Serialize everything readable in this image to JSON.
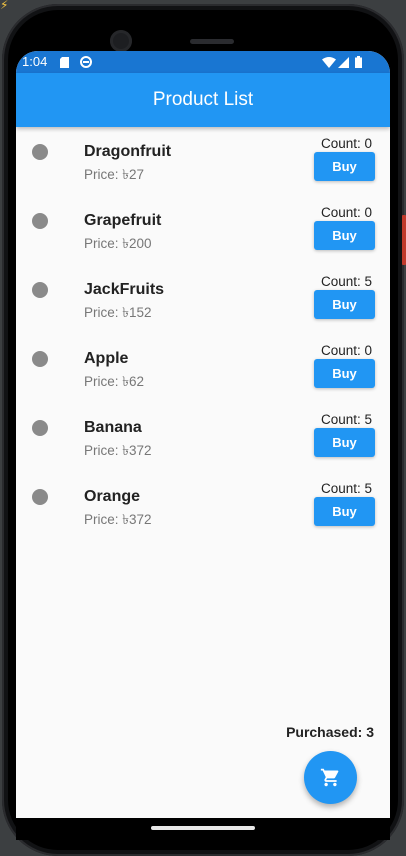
{
  "status_bar": {
    "time": "1:04"
  },
  "app_bar": {
    "title": "Product List"
  },
  "products": [
    {
      "name": "Dragonfruit",
      "price": "Price: ৳27",
      "count": "Count: 0",
      "buy_label": "Buy"
    },
    {
      "name": "Grapefruit",
      "price": "Price: ৳200",
      "count": "Count: 0",
      "buy_label": "Buy"
    },
    {
      "name": "JackFruits",
      "price": "Price: ৳152",
      "count": "Count: 5",
      "buy_label": "Buy"
    },
    {
      "name": "Apple",
      "price": "Price: ৳62",
      "count": "Count: 0",
      "buy_label": "Buy"
    },
    {
      "name": "Banana",
      "price": "Price: ৳372",
      "count": "Count: 5",
      "buy_label": "Buy"
    },
    {
      "name": "Orange",
      "price": "Price: ৳372",
      "count": "Count: 5",
      "buy_label": "Buy"
    }
  ],
  "footer": {
    "purchased": "Purchased: 3"
  },
  "fab": {
    "icon": "shopping-cart-icon"
  },
  "colors": {
    "primary": "#2196f3",
    "status_bar": "#1976d2",
    "background": "#fafafa",
    "dot": "#8a8a8a"
  }
}
